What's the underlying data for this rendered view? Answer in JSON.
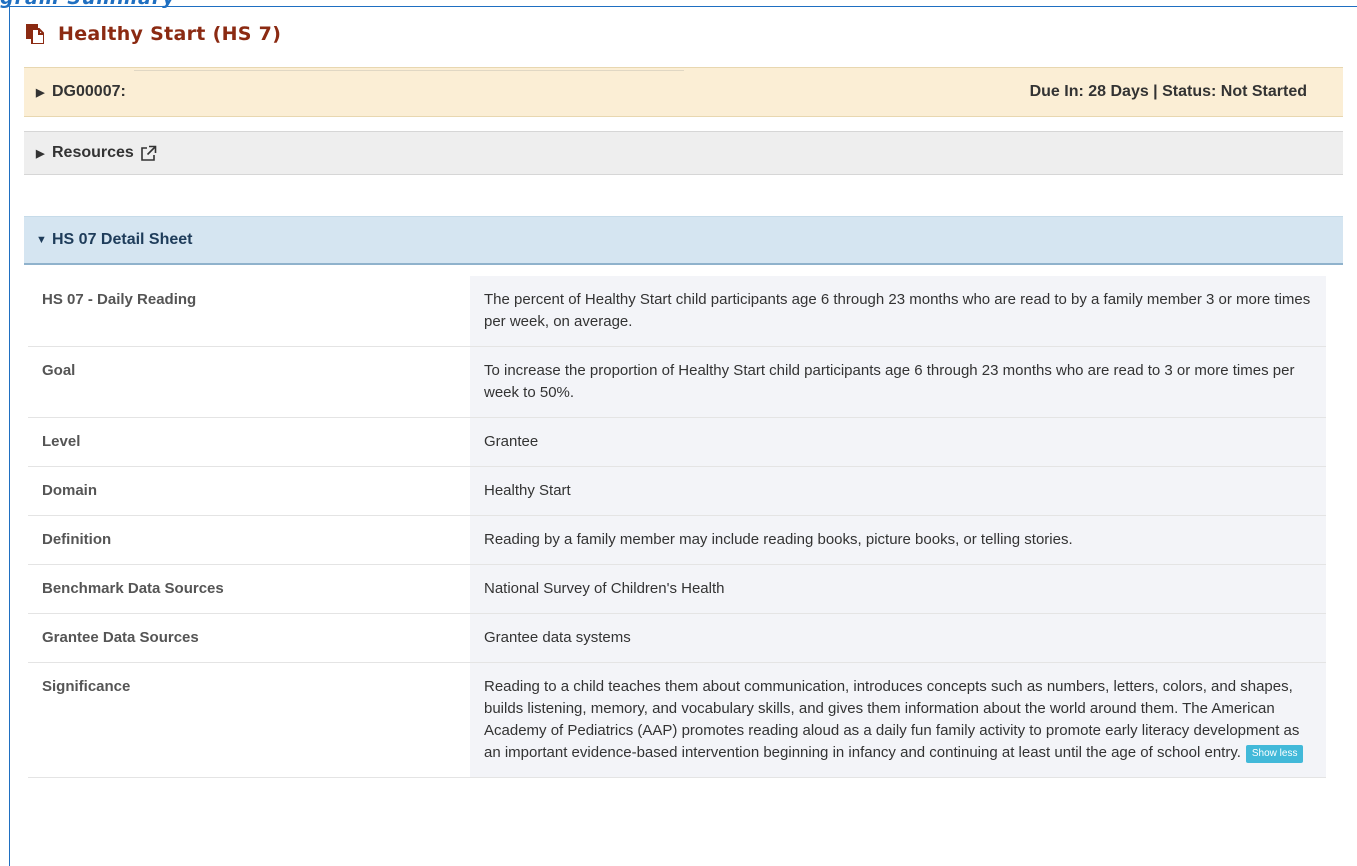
{
  "header_fragment": "gram Summary",
  "page": {
    "title": "Healthy Start (HS 7)"
  },
  "accordions": {
    "dg": {
      "label": "DG00007:",
      "status": "Due In: 28 Days | Status: Not Started"
    },
    "resources": {
      "label": "Resources"
    },
    "detail": {
      "label": "HS 07 Detail Sheet"
    }
  },
  "detail_rows": [
    {
      "label": "HS 07 - Daily Reading",
      "value": "The percent of Healthy Start child participants age 6 through 23 months who are read to by a family member 3 or more times per week, on average."
    },
    {
      "label": "Goal",
      "value": "To increase the proportion of Healthy Start child participants age 6 through 23 months who are read to 3 or more times per week to 50%."
    },
    {
      "label": "Level",
      "value": "Grantee"
    },
    {
      "label": "Domain",
      "value": "Healthy Start"
    },
    {
      "label": "Definition",
      "value": "Reading by a family member may include reading books, picture books, or telling stories."
    },
    {
      "label": "Benchmark Data Sources",
      "value": "National Survey of Children's Health"
    },
    {
      "label": "Grantee Data Sources",
      "value": "Grantee data systems"
    },
    {
      "label": "Significance",
      "value": "Reading to a child teaches them about communication, introduces concepts such as numbers, letters, colors, and shapes, builds listening, memory, and vocabulary skills, and gives them information about the world around them. The American Academy of Pediatrics (AAP) promotes reading aloud as a daily fun family activity to promote early literacy development as an important evidence-based intervention beginning in infancy and continuing at least until the age of school entry."
    }
  ],
  "show_less_label": "Show less",
  "icons": {
    "page_title_icon": "document-copy-icon",
    "dg_caret": "caret-right-icon",
    "resources_caret": "caret-right-icon",
    "resources_link": "external-link-icon",
    "detail_caret": "caret-down-icon"
  },
  "colors": {
    "title": "#8b2a12",
    "frame_border": "#1f6fc1",
    "dg_bg": "#fbeed5",
    "resources_bg": "#eeeeee",
    "detail_header_bg": "#d5e5f1",
    "value_bg": "#f3f4f8",
    "show_less_bg": "#42b9d9"
  }
}
